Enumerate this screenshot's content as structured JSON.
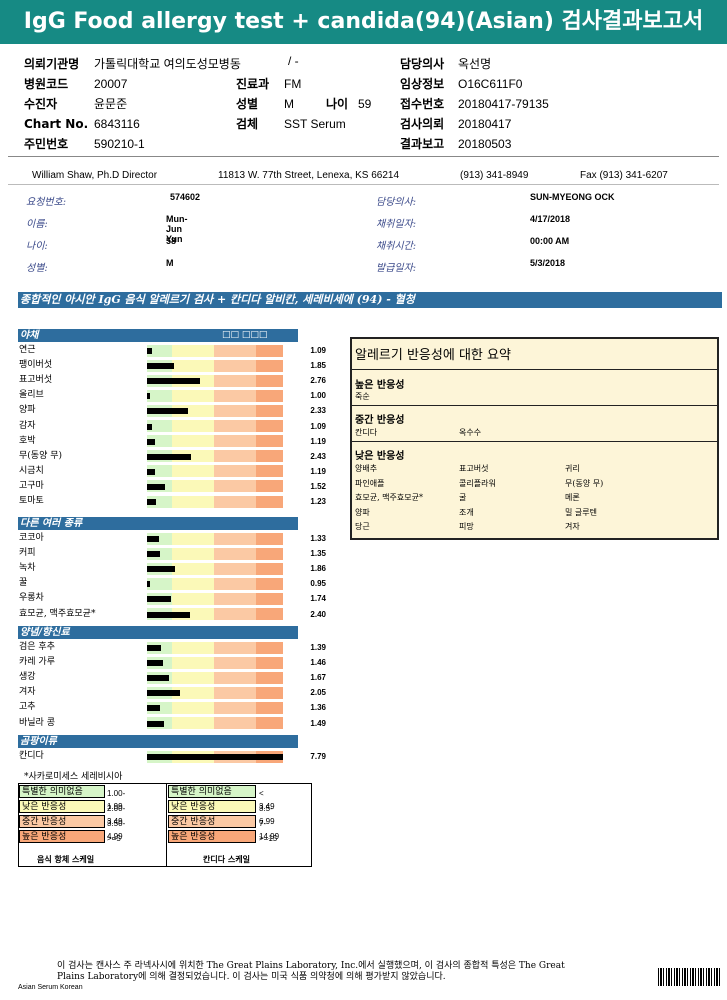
{
  "title": "IgG Food allergy test + candida(94)(Asian) 검사결과보고서",
  "header": {
    "left": [
      {
        "label": "의뢰기관명",
        "value": "가톨릭대학교 여의도성모병동"
      },
      {
        "label": "병원코드",
        "value": "20007"
      },
      {
        "label": "수진자",
        "value": "윤문준"
      },
      {
        "label": "Chart No.",
        "value": "6843116"
      },
      {
        "label": "주민번호",
        "value": "590210-1"
      }
    ],
    "middle": {
      "slash": "/ -",
      "dept_label": "진료과",
      "dept_value": "FM",
      "sex_label": "성별",
      "sex_value": "M",
      "age_label": "나이",
      "age_value": "59",
      "specimen_label": "검체",
      "specimen_value": "SST Serum"
    },
    "right": [
      {
        "label": "담당의사",
        "value": "옥선명"
      },
      {
        "label": "임상정보",
        "value": "O16C611F0"
      },
      {
        "label": "접수번호",
        "value": "20180417-79135"
      },
      {
        "label": "검사의뢰",
        "value": "20180417"
      },
      {
        "label": "결과보고",
        "value": "20180503"
      }
    ]
  },
  "lab": {
    "director": "William Shaw, Ph.D  Director",
    "address": "11813 W. 77th Street, Lenexa, KS 66214",
    "phone": "(913) 341-8949",
    "fax": "Fax (913) 341-6207"
  },
  "info": {
    "left": [
      {
        "label": "요청번호:",
        "value": "574602"
      },
      {
        "label": "이름:",
        "value": "Mun-Jun Yun"
      },
      {
        "label": "나이:",
        "value": "58"
      },
      {
        "label": "성별:",
        "value": "M"
      }
    ],
    "right": [
      {
        "label": "담당의사:",
        "value": "SUN-MYEONG OCK"
      },
      {
        "label": "채취일자:",
        "value": "4/17/2018"
      },
      {
        "label": "채취시간:",
        "value": "00:00  AM"
      },
      {
        "label": "발급일자:",
        "value": "5/3/2018"
      }
    ]
  },
  "banner": "종합적인 아시안 IgG 음식 알레르기 검사 + 칸디다 알비칸, 세레비세에 (94) - 혈청",
  "categories": [
    {
      "name": "야채",
      "header": "□□ □□□",
      "items": [
        {
          "name": "연근",
          "value": 1.09
        },
        {
          "name": "팽이버섯",
          "value": 1.85
        },
        {
          "name": "표고버섯",
          "value": 2.76
        },
        {
          "name": "올리브",
          "value": 1.0
        },
        {
          "name": "양파",
          "value": 2.33
        },
        {
          "name": "감자",
          "value": 1.09
        },
        {
          "name": "호박",
          "value": 1.19
        },
        {
          "name": "무(동양 무)",
          "value": 2.43
        },
        {
          "name": "시금치",
          "value": 1.19
        },
        {
          "name": "고구마",
          "value": 1.52
        },
        {
          "name": "토마토",
          "value": 1.23
        }
      ]
    },
    {
      "name": "다른 여러 종류",
      "header": "",
      "items": [
        {
          "name": "코코아",
          "value": 1.33
        },
        {
          "name": "커피",
          "value": 1.35
        },
        {
          "name": "녹차",
          "value": 1.86
        },
        {
          "name": "꿀",
          "value": 0.95
        },
        {
          "name": "우롱차",
          "value": 1.74
        },
        {
          "name": "효모균, 맥주효모균*",
          "value": 2.4
        }
      ]
    },
    {
      "name": "양념/향신료",
      "header": "",
      "items": [
        {
          "name": "검은 후추",
          "value": 1.39
        },
        {
          "name": "카레 가루",
          "value": 1.46
        },
        {
          "name": "생강",
          "value": 1.67
        },
        {
          "name": "겨자",
          "value": 2.05
        },
        {
          "name": "고추",
          "value": 1.36
        },
        {
          "name": "바닐라 콩",
          "value": 1.49
        }
      ]
    },
    {
      "name": "곰팡이류",
      "header": "",
      "items": [
        {
          "name": "칸디다",
          "value": 7.79
        }
      ]
    }
  ],
  "footnote": "*사카로미세스 세레비시아",
  "summary": {
    "title": "알레르기 반응성에 대한 요약",
    "high": {
      "label": "높은 반응성",
      "items": [
        "죽순"
      ]
    },
    "mid": {
      "label": "중간 반응성",
      "items": [
        "칸디다",
        "옥수수"
      ]
    },
    "low": {
      "label": "낮은 반응성",
      "items": [
        "양배추",
        "표고버섯",
        "귀리",
        "파인애플",
        "콜리플라워",
        "무(동양 무)",
        "효모균, 맥주효모균*",
        "굴",
        "메론",
        "양파",
        "조개",
        "밀 글루텐",
        "당근",
        "피망",
        "겨자"
      ]
    }
  },
  "legend": {
    "food": {
      "caption": "음식 항체 스케일",
      "rows": [
        {
          "label": "특별한 의미없음",
          "range": "1.00-1.99",
          "color": "#d6f5c8"
        },
        {
          "label": "낮은 반응성",
          "range": "2.00-3.49",
          "color": "#fbf9b8"
        },
        {
          "label": "중간 반응성",
          "range": "3.50-4.99",
          "color": "#fbc9a4"
        },
        {
          "label": "높은 반응성",
          "range": ">=5",
          "color": "#f8a779"
        }
      ]
    },
    "candida": {
      "caption": "칸디다 스케일",
      "rows": [
        {
          "label": "특별한 의미없음",
          "range": "< 3.49",
          "color": "#d6f5c8"
        },
        {
          "label": "낮은 반응성",
          "range": "3.5-6.99",
          "color": "#fbf9b8"
        },
        {
          "label": "중간 반응성",
          "range": "7-14.99",
          "color": "#fbc9a4"
        },
        {
          "label": "높은 반응성",
          "range": ">=15",
          "color": "#f8a779"
        }
      ]
    }
  },
  "footer": {
    "line1": "이 검사는 캔사스 주 라넥사시에 위치한 The Great Plains Laboratory, Inc.에서 실행했으며, 이 검사의 종합적 특성은 The Great",
    "line2": "Plains Laboratory에 의해 결정되었습니다. 이 검사는 미국 식품 의약청에 의해 평가받지 않았습니다.",
    "tag": "Asian Serum Korean"
  }
}
